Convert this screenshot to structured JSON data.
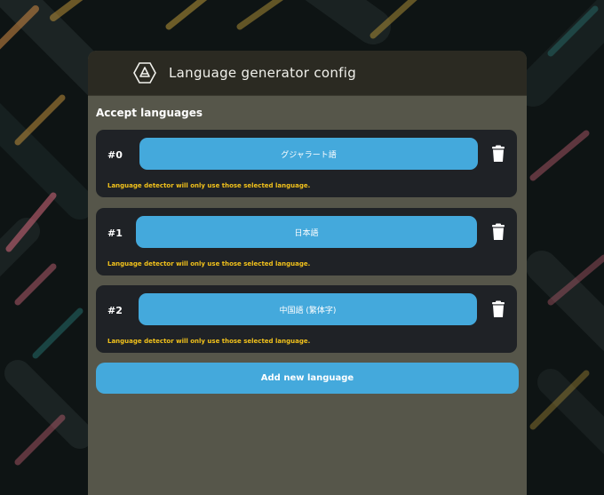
{
  "header": {
    "title": "Language generator config",
    "logo_icon": "triangle-logo-icon"
  },
  "section": {
    "title": "Accept languages"
  },
  "languages": [
    {
      "index": "#0",
      "label": "グジャラート語",
      "hint": "Language detector will only use those selected language."
    },
    {
      "index": "#1",
      "label": "日本語",
      "hint": "Language detector will only use those selected language."
    },
    {
      "index": "#2",
      "label": "中国語 (繁体字)",
      "hint": "Language detector will only use those selected language."
    }
  ],
  "add_button": {
    "label": "Add new language"
  },
  "colors": {
    "accent": "#44a9dc",
    "warning": "#f2c21b",
    "panel": "#56564a",
    "card": "#1f2226",
    "header": "#2b2a22"
  }
}
